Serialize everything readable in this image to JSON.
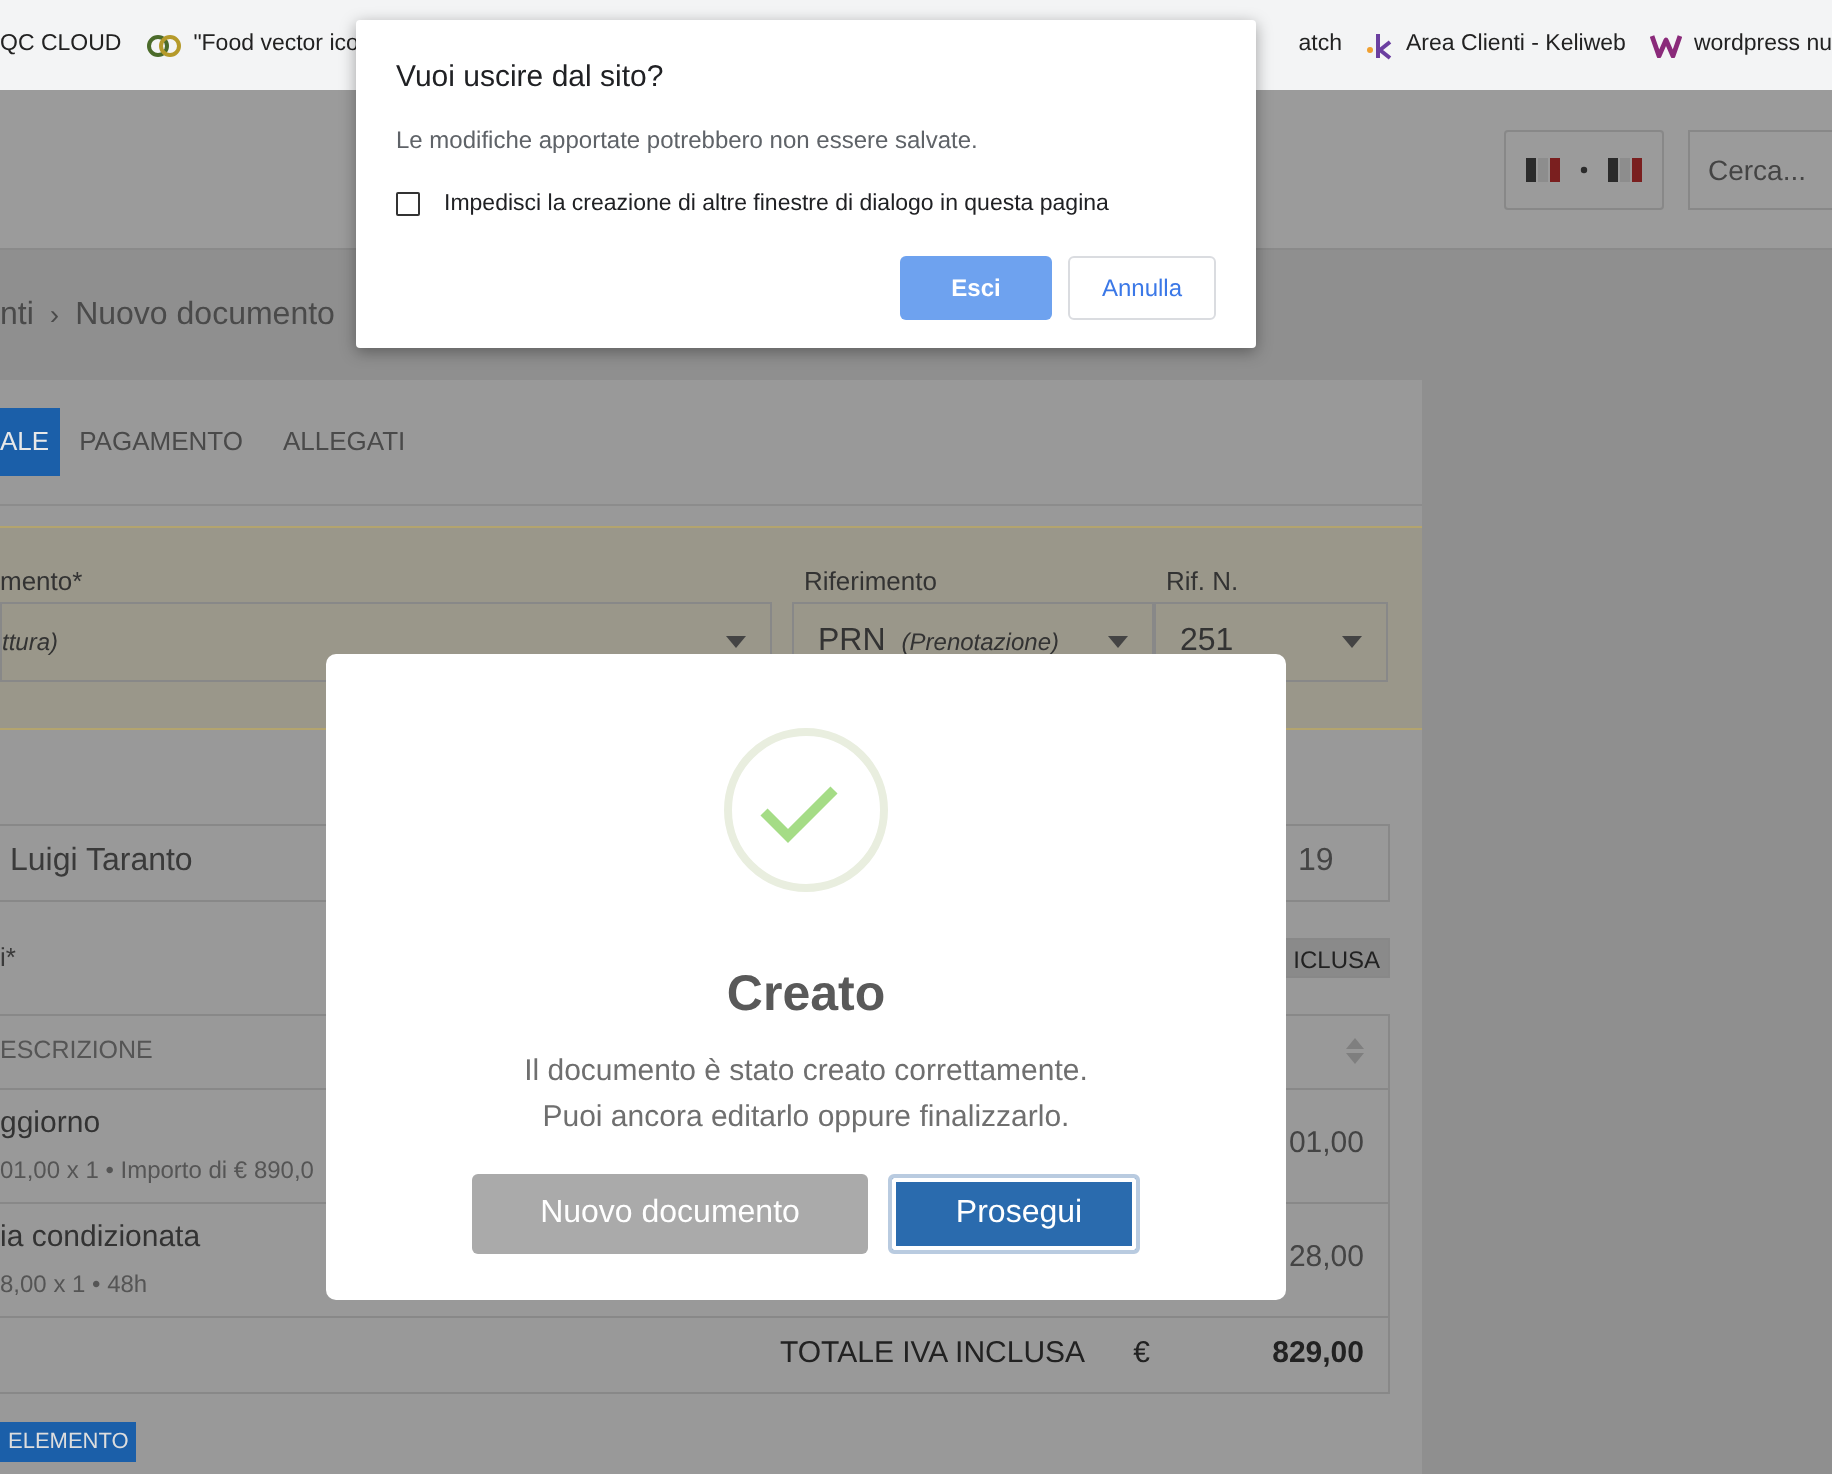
{
  "bookmarks": [
    {
      "label": "QC CLOUD",
      "kind": "plain"
    },
    {
      "label": "\"Food vector ico",
      "kind": "rings"
    },
    {
      "label": "atch",
      "kind": "plain"
    },
    {
      "label": "Area Clienti - Keliweb",
      "kind": "k"
    },
    {
      "label": "wordpress nu",
      "kind": "w"
    }
  ],
  "header": {
    "search": {
      "placeholder": "Cerca..."
    }
  },
  "breadcrumb": {
    "items": [
      "nti",
      "Nuovo documento"
    ],
    "separator": "›"
  },
  "tabs": [
    {
      "label": "ALE",
      "selected": true
    },
    {
      "label": "PAGAMENTO",
      "selected": false
    },
    {
      "label": "ALLEGATI",
      "selected": false
    }
  ],
  "document_fields": [
    {
      "label": "mento*",
      "note": "ttura)"
    },
    {
      "label": "Riferimento",
      "value": "PRN",
      "note": "(Prenotazione)"
    },
    {
      "label": "Rif. N.",
      "value": "251"
    }
  ],
  "customer": {
    "value": "Luigi Taranto"
  },
  "date": {
    "value": "19"
  },
  "items_label": "i*",
  "vat_toggle": "ICLUSA",
  "table": {
    "columns": [
      "ESCRIZIONE"
    ],
    "rows": [
      {
        "title": "ggiorno",
        "detail": "01,00 x 1 • Importo di € 890,0",
        "amount": "01,00"
      },
      {
        "title": "ia condizionata",
        "detail": "8,00 x 1 • 48h",
        "amount": "28,00"
      }
    ],
    "total": {
      "label": "TOTALE IVA INCLUSA",
      "currency": "€",
      "amount": "829,00"
    }
  },
  "add_button": "ELEMENTO",
  "success_modal": {
    "title": "Creato",
    "lines": [
      "Il documento è stato creato correttamente.",
      "Puoi ancora editarlo oppure finalizzarlo."
    ],
    "buttons": [
      {
        "label": "Nuovo documento",
        "kind": "secondary",
        "focused": false
      },
      {
        "label": "Prosegui",
        "kind": "primary",
        "focused": true
      }
    ]
  },
  "leave_dialog": {
    "title": "Vuoi uscire dal sito?",
    "message": "Le modifiche apportate potrebbero non essere salvate.",
    "checkbox": {
      "label": "Impedisci la creazione di altre finestre di dialogo in questa pagina",
      "checked": false
    },
    "buttons": [
      {
        "label": "Esci",
        "kind": "primary"
      },
      {
        "label": "Annulla",
        "kind": "secondary"
      }
    ]
  }
}
